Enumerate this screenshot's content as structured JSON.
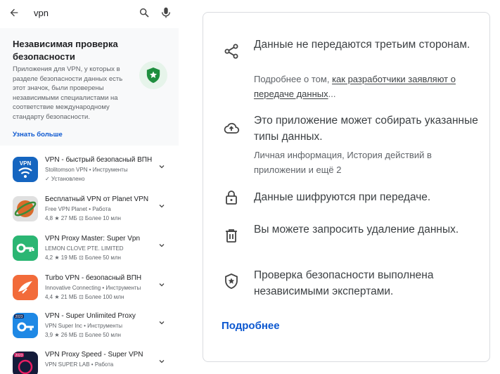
{
  "search": {
    "query": "vpn"
  },
  "safety_card": {
    "title": "Независимая проверка безопасности",
    "description": "Приложения для VPN, у которых в разделе безопасности данных есть этот значок, были проверены независимыми специалистами на соответствие международному стандарту безопасности.",
    "link": "Узнать больше"
  },
  "apps": [
    {
      "name": "VPN - быстрый безопасный ВПН",
      "developer": "Stolitomson VPN • Инструменты",
      "meta": "✓ Установлено",
      "icon_color": "#1565c0"
    },
    {
      "name": "Бесплатный VPN от Planet VPN",
      "developer": "Free VPN Planet • Работа",
      "meta": "4,8 ★   27 МБ   ⊡ Более 10 млн",
      "icon_color": "#e0e0e0"
    },
    {
      "name": "VPN Proxy Master: Super Vpn",
      "developer": "LEMON CLOVE PTE. LIMITED",
      "meta": "4,2 ★   19 МБ   ⊡ Более 50 млн",
      "icon_color": "#2bb673"
    },
    {
      "name": "Turbo VPN - безопасный ВПН",
      "developer": "Innovative Connecting • Инструменты",
      "meta": "4,4 ★   21 МБ   ⊡ Более 100 млн",
      "icon_color": "#f26b3a"
    },
    {
      "name": "VPN - Super Unlimited Proxy",
      "developer": "VPN Super Inc • Инструменты",
      "meta": "3,9 ★   26 МБ   ⊡ Более 50 млн",
      "icon_color": "#1e88e5"
    },
    {
      "name": "VPN Proxy Speed - Super VPN",
      "developer": "VPN SUPER LAB • Работа",
      "meta": "",
      "icon_color": "#141b3a"
    }
  ],
  "data_safety": {
    "items": [
      {
        "icon": "share-icon",
        "main": "Данные не передаются третьим сторонам.",
        "sub_prefix": "Подробнее о том, ",
        "sub_link": "как разработчики заявляют о передаче данных",
        "sub_suffix": "..."
      },
      {
        "icon": "cloud-upload-icon",
        "main": "Это приложение может собирать указанные типы данных.",
        "sub": "Личная информация, История действий в приложении и ещё 2"
      },
      {
        "icon": "lock-icon",
        "main": "Данные шифруются при передаче."
      },
      {
        "icon": "trash-icon",
        "main": "Вы можете запросить удаление данных."
      },
      {
        "icon": "shield-star-icon",
        "main": "Проверка безопасности выполнена независимыми экспертами."
      }
    ],
    "details_link": "Подробнее"
  }
}
